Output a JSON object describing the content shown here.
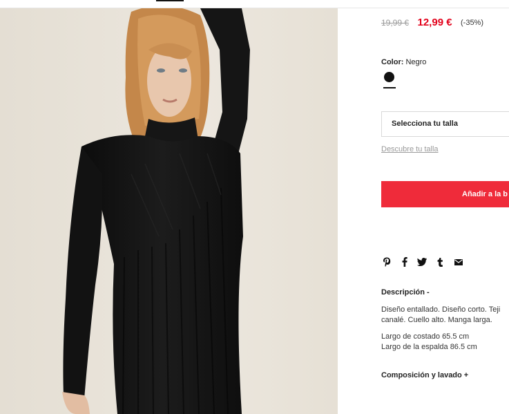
{
  "product": {
    "price_old": "19,99 €",
    "price_new": "12,99 €",
    "discount": "(-35%)",
    "color_label": "Color:",
    "color_value": "Negro",
    "swatch_color": "#111111",
    "size_placeholder": "Selecciona tu talla",
    "size_guide_link": "Descubre tu talla",
    "add_to_bag": "Añadir a la b",
    "share_icons": [
      "pinterest-icon",
      "facebook-icon",
      "twitter-icon",
      "tumblr-icon",
      "email-icon"
    ],
    "description_title": "Descripción -",
    "description_lines": [
      "Diseño entallado. Diseño corto. Teji",
      "canalé. Cuello alto. Manga larga."
    ],
    "measure_lines": [
      "Largo de costado 65.5 cm",
      "Largo de la espalda 86.5 cm"
    ],
    "composition_title": "Composición y lavado +"
  },
  "colors": {
    "accent_red": "#ef2b3a",
    "price_red": "#e2001a",
    "dress": "#141414",
    "background": "#e9e3d9"
  }
}
